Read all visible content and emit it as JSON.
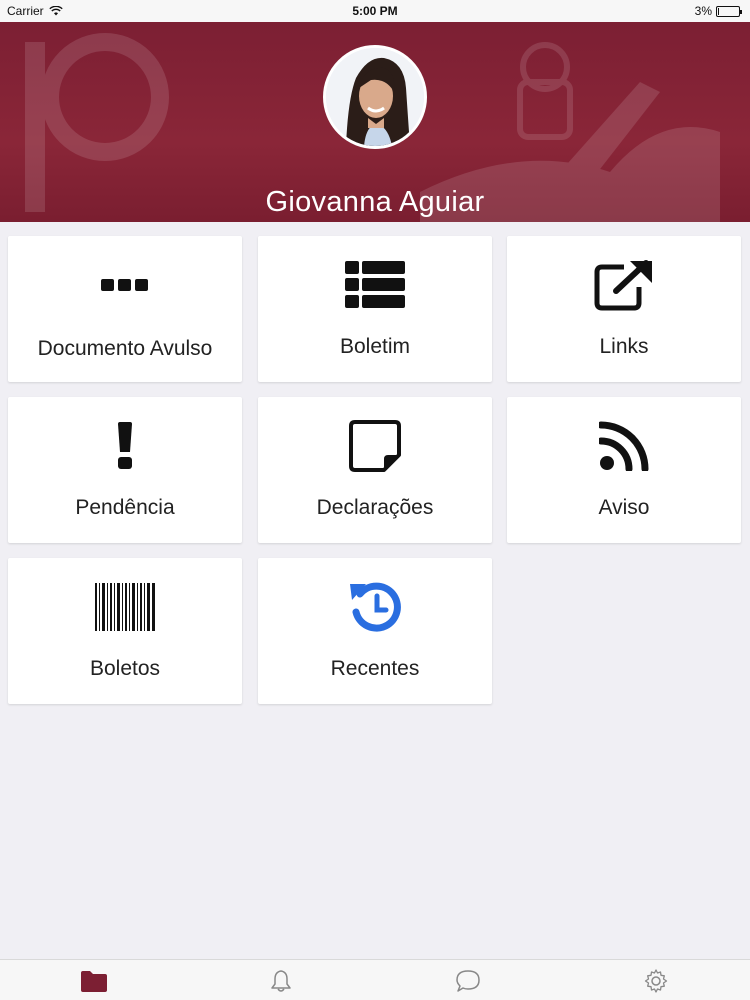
{
  "status_bar": {
    "carrier": "Carrier",
    "time": "5:00 PM",
    "battery": "3%",
    "battery_level": 0.03
  },
  "profile": {
    "name": "Giovanna Aguiar"
  },
  "tiles": [
    {
      "label": "Documento Avulso",
      "icon": "ellipsis-icon"
    },
    {
      "label": "Boletim",
      "icon": "list-icon"
    },
    {
      "label": "Links",
      "icon": "external-link-icon"
    },
    {
      "label": "Pendência",
      "icon": "exclamation-icon"
    },
    {
      "label": "Declarações",
      "icon": "sticky-note-icon"
    },
    {
      "label": "Aviso",
      "icon": "rss-icon"
    },
    {
      "label": "Boletos",
      "icon": "barcode-icon"
    },
    {
      "label": "Recentes",
      "icon": "history-icon"
    }
  ],
  "tab_bar": {
    "items": [
      {
        "icon": "folder-icon",
        "active": true
      },
      {
        "icon": "bell-icon",
        "active": false
      },
      {
        "icon": "chat-icon",
        "active": false
      },
      {
        "icon": "gear-icon",
        "active": false
      }
    ]
  },
  "colors": {
    "brand": "#7c1f33",
    "accent_blue": "#2a6ee0",
    "background": "#f0eff4"
  }
}
